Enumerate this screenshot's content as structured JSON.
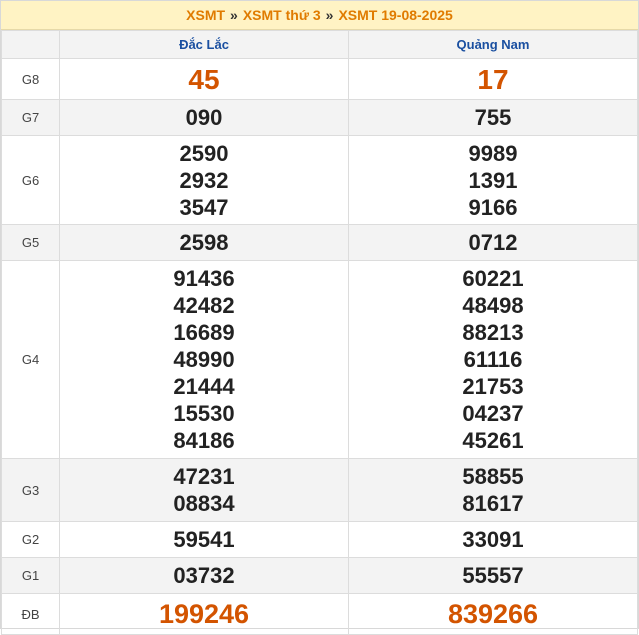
{
  "breadcrumb": {
    "item1": "XSMT",
    "item2": "XSMT thứ 3",
    "item3": "XSMT 19-08-2025",
    "separator": "»"
  },
  "provinces": [
    "Đắc Lắc",
    "Quảng Nam"
  ],
  "prizes": [
    {
      "label": "G8",
      "cols": [
        [
          "45"
        ],
        [
          "17"
        ]
      ]
    },
    {
      "label": "G7",
      "cols": [
        [
          "090"
        ],
        [
          "755"
        ]
      ]
    },
    {
      "label": "G6",
      "cols": [
        [
          "2590",
          "2932",
          "3547"
        ],
        [
          "9989",
          "1391",
          "9166"
        ]
      ]
    },
    {
      "label": "G5",
      "cols": [
        [
          "2598"
        ],
        [
          "0712"
        ]
      ]
    },
    {
      "label": "G4",
      "cols": [
        [
          "91436",
          "42482",
          "16689",
          "48990",
          "21444",
          "15530",
          "84186"
        ],
        [
          "60221",
          "48498",
          "88213",
          "61116",
          "21753",
          "04237",
          "45261"
        ]
      ]
    },
    {
      "label": "G3",
      "cols": [
        [
          "47231",
          "08834"
        ],
        [
          "58855",
          "81617"
        ]
      ]
    },
    {
      "label": "G2",
      "cols": [
        [
          "59541"
        ],
        [
          "33091"
        ]
      ]
    },
    {
      "label": "G1",
      "cols": [
        [
          "03732"
        ],
        [
          "55557"
        ]
      ]
    },
    {
      "label": "ĐB",
      "cols": [
        [
          "199246"
        ],
        [
          "839266"
        ]
      ]
    }
  ],
  "colors": {
    "accent": "#e07b00",
    "special": "#d35400",
    "province": "#1a4fa0",
    "header_bg": "#fff3c4"
  }
}
